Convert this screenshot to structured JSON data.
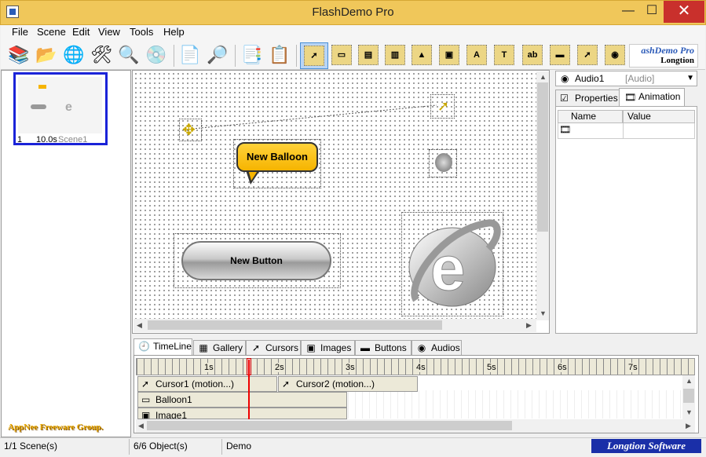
{
  "window": {
    "title": "FlashDemo Pro",
    "minimize": "—",
    "maximize": "☐",
    "close": "✕"
  },
  "menu": [
    "File",
    "Scene",
    "Edit",
    "View",
    "Tools",
    "Help"
  ],
  "brand": {
    "title": "ashDemo Pro",
    "subtitle": "Longtion"
  },
  "scene": {
    "number": "1",
    "duration": "10.0s",
    "name": "Scene1"
  },
  "watermark": "AppNee Freeware Group.",
  "canvas": {
    "balloon_text": "New Balloon",
    "button_text": "New Button"
  },
  "properties": {
    "object_name": "Audio1",
    "object_type": "[Audio]",
    "tabs": [
      "Properties",
      "Animation"
    ],
    "columns": [
      "Name",
      "Value"
    ]
  },
  "bottom_tabs": [
    "TimeLine",
    "Gallery",
    "Cursors",
    "Images",
    "Buttons",
    "Audios"
  ],
  "ruler": [
    "1s",
    "2s",
    "3s",
    "4s",
    "5s",
    "6s",
    "7s"
  ],
  "tracks": {
    "cursor1": "Cursor1 (motion...)",
    "cursor2": "Cursor2 (motion...)",
    "balloon": "Balloon1",
    "image": "Image1"
  },
  "status": {
    "scenes": "1/1 Scene(s)",
    "objects": "6/6 Object(s)",
    "project": "Demo",
    "brand": "Longtion Software"
  }
}
